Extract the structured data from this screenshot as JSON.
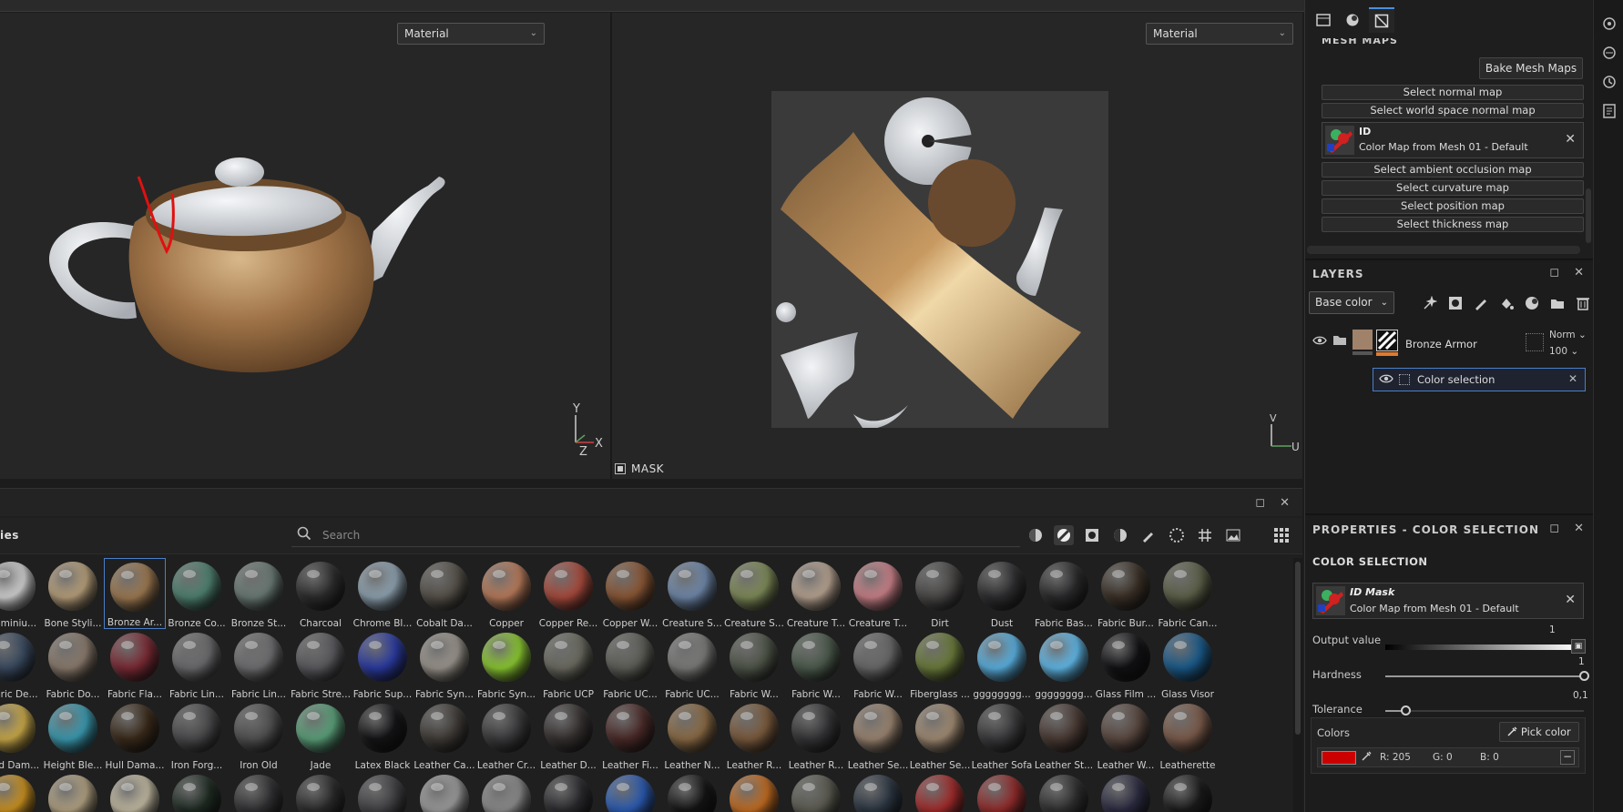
{
  "viewports": {
    "left": {
      "mode": "Material",
      "axes": {
        "y": "Y",
        "x": "X",
        "z": "Z"
      }
    },
    "right": {
      "mode": "Material",
      "axes": {
        "v": "V",
        "u": "U"
      },
      "mask_label": "MASK"
    }
  },
  "shelf": {
    "title": "ies",
    "search_placeholder": "Search",
    "filter_icons": [
      "smart-material-icon",
      "material-icon",
      "mask-icon",
      "smart-mask-icon",
      "brush-icon",
      "particles-icon",
      "texture-icon",
      "environment-icon"
    ],
    "rows": [
      [
        {
          "label": "Aluminiu...",
          "color": "#d0d0d0"
        },
        {
          "label": "Bone Styli...",
          "color": "#b79f7a"
        },
        {
          "label": "Bronze Ar...",
          "color": "#9c7850",
          "selected": true
        },
        {
          "label": "Bronze Co...",
          "color": "#4e8070"
        },
        {
          "label": "Bronze St...",
          "color": "#6a7a74"
        },
        {
          "label": "Charcoal",
          "color": "#2c2c2c"
        },
        {
          "label": "Chrome Bl...",
          "color": "#8ea2b0"
        },
        {
          "label": "Cobalt Da...",
          "color": "#555049"
        },
        {
          "label": "Copper",
          "color": "#b87a5a"
        },
        {
          "label": "Copper Re...",
          "color": "#a84a3c"
        },
        {
          "label": "Copper W...",
          "color": "#8a5634"
        },
        {
          "label": "Creature S...",
          "color": "#6f88aa"
        },
        {
          "label": "Creature S...",
          "color": "#7e8a58"
        },
        {
          "label": "Creature T...",
          "color": "#b6a290"
        },
        {
          "label": "Creature T...",
          "color": "#c98088"
        },
        {
          "label": "Dirt",
          "color": "#4a4847"
        },
        {
          "label": "Dust",
          "color": "#2e2e30"
        },
        {
          "label": "Fabric Bas...",
          "color": "#2a2a2c"
        },
        {
          "label": "Fabric Bur...",
          "color": "#3a3026"
        },
        {
          "label": "Fabric Can...",
          "color": "#5c6048"
        }
      ],
      [
        {
          "label": "Fabric De...",
          "color": "#3a4a60"
        },
        {
          "label": "Fabric Do...",
          "color": "#8a7a6c"
        },
        {
          "label": "Fabric Fla...",
          "color": "#7a2a34"
        },
        {
          "label": "Fabric Lin...",
          "color": "#6a6a6c"
        },
        {
          "label": "Fabric Lin...",
          "color": "#6e6e70"
        },
        {
          "label": "Fabric Stre...",
          "color": "#5a5a5e"
        },
        {
          "label": "Fabric Sup...",
          "color": "#2a3aa0"
        },
        {
          "label": "Fabric Syn...",
          "color": "#9a948c"
        },
        {
          "label": "Fabric Syn...",
          "color": "#8ac830"
        },
        {
          "label": "Fabric UCP",
          "color": "#6a6a60"
        },
        {
          "label": "Fabric UC...",
          "color": "#5e5e58"
        },
        {
          "label": "Fabric UC...",
          "color": "#7a7a78"
        },
        {
          "label": "Fabric W...",
          "color": "#4e5448"
        },
        {
          "label": "Fabric W...",
          "color": "#4c5a4c"
        },
        {
          "label": "Fabric W...",
          "color": "#686868"
        },
        {
          "label": "Fiberglass ...",
          "color": "#6a7a3a"
        },
        {
          "label": "gggggggg...",
          "color": "#5ab0e0"
        },
        {
          "label": "gggggggg...",
          "color": "#60b8e8"
        },
        {
          "label": "Glass Film ...",
          "color": "#111114"
        },
        {
          "label": "Glass Visor",
          "color": "#1a5a8a"
        }
      ],
      [
        {
          "label": "Gold Dam...",
          "color": "#c8a848"
        },
        {
          "label": "Height Ble...",
          "color": "#3a9ab0"
        },
        {
          "label": "Hull Dama...",
          "color": "#3a2a1a"
        },
        {
          "label": "Iron Forg...",
          "color": "#4a4a4c"
        },
        {
          "label": "Iron Old",
          "color": "#505050"
        },
        {
          "label": "Jade",
          "color": "#5aa07a"
        },
        {
          "label": "Latex Black",
          "color": "#141416"
        },
        {
          "label": "Leather Ca...",
          "color": "#3e3a36"
        },
        {
          "label": "Leather Cr...",
          "color": "#3a3a3c"
        },
        {
          "label": "Leather D...",
          "color": "#363030"
        },
        {
          "label": "Leather Fi...",
          "color": "#4a2a28"
        },
        {
          "label": "Leather N...",
          "color": "#8a6a44"
        },
        {
          "label": "Leather R...",
          "color": "#7a5a3c"
        },
        {
          "label": "Leather R...",
          "color": "#343436"
        },
        {
          "label": "Leather Se...",
          "color": "#9a8470"
        },
        {
          "label": "Leather Se...",
          "color": "#a08a72"
        },
        {
          "label": "Leather Sofa",
          "color": "#3a3a3c"
        },
        {
          "label": "Leather St...",
          "color": "#4a3a34"
        },
        {
          "label": "Leather W...",
          "color": "#5a4840"
        },
        {
          "label": "Leatherette",
          "color": "#7a5a4a"
        }
      ],
      [
        {
          "label": "",
          "color": "#c89020"
        },
        {
          "label": "",
          "color": "#b0a080"
        },
        {
          "label": "",
          "color": "#c0b8a0"
        },
        {
          "label": "",
          "color": "#1e2a22"
        },
        {
          "label": "",
          "color": "#303032"
        },
        {
          "label": "",
          "color": "#2a2a2a"
        },
        {
          "label": "",
          "color": "#404044"
        },
        {
          "label": "",
          "color": "#9a9a9a"
        },
        {
          "label": "",
          "color": "#8a8a8a"
        },
        {
          "label": "",
          "color": "#2a2a2e"
        },
        {
          "label": "",
          "color": "#2a5ab0"
        },
        {
          "label": "",
          "color": "#141414"
        },
        {
          "label": "",
          "color": "#c06a20"
        },
        {
          "label": "",
          "color": "#5a5a50"
        },
        {
          "label": "",
          "color": "#2a3440"
        },
        {
          "label": "",
          "color": "#a02a2a"
        },
        {
          "label": "",
          "color": "#902a2a"
        },
        {
          "label": "",
          "color": "#2e2e2e"
        },
        {
          "label": "",
          "color": "#2a2a40"
        },
        {
          "label": "",
          "color": "#1a1a1a"
        }
      ]
    ]
  },
  "mesh_maps": {
    "header": "MESH MAPS",
    "bake_button": "Bake Mesh Maps",
    "normal": "Select normal map",
    "world_normal": "Select world space normal map",
    "id_slot": {
      "title": "ID",
      "value": "Color Map from Mesh 01 - Default"
    },
    "ao": "Select ambient occlusion map",
    "curvature": "Select curvature map",
    "position": "Select position map",
    "thickness": "Select thickness map"
  },
  "layers": {
    "title": "LAYERS",
    "channel": "Base color",
    "layer": {
      "name": "Bronze Armor",
      "blend": "Norm",
      "opacity": "100"
    },
    "effect": {
      "name": "Color selection"
    }
  },
  "properties": {
    "title": "PROPERTIES - COLOR SELECTION",
    "section": "COLOR SELECTION",
    "id_mask": {
      "title": "ID Mask",
      "value": "Color Map from Mesh 01 - Default"
    },
    "output_value": {
      "label": "Output value",
      "value": "1",
      "level": 1.0
    },
    "hardness": {
      "label": "Hardness",
      "value": "1",
      "level": 1.0
    },
    "tolerance": {
      "label": "Tolerance",
      "value": "0,1",
      "level": 0.1
    },
    "colors_label": "Colors",
    "pick_color": "Pick color",
    "color": {
      "hex": "#cd0000",
      "r": "R: 205",
      "g": "G: 0",
      "b": "B: 0"
    }
  }
}
